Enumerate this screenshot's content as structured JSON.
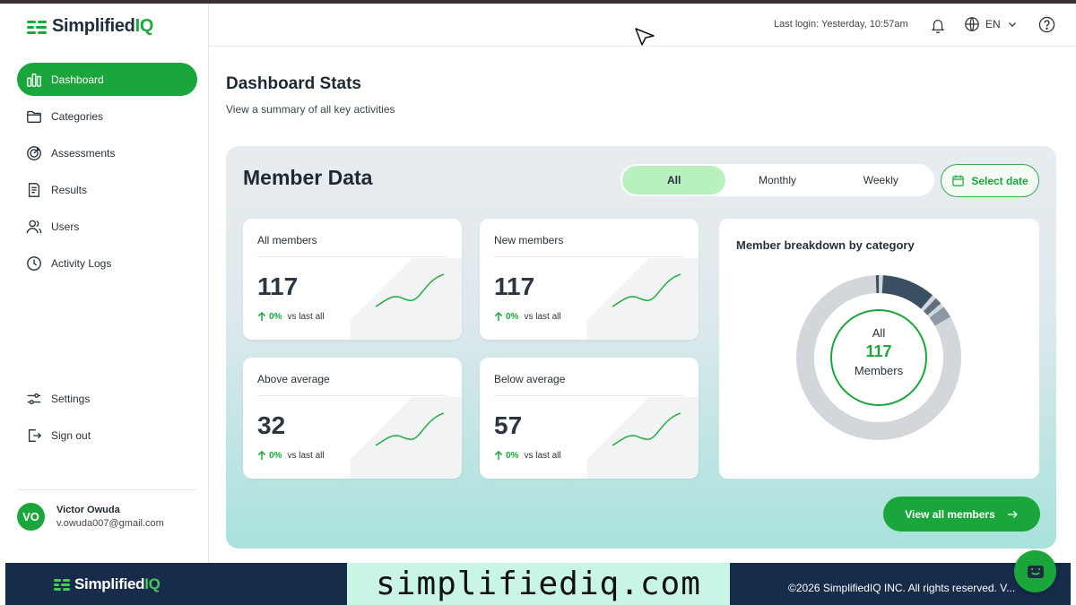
{
  "app": {
    "brand_prefix": "Simplified",
    "brand_suffix": "IQ",
    "accent_color": "#1aa63a"
  },
  "header": {
    "last_login": "Last login: Yesterday, 10:57am",
    "language": "EN"
  },
  "sidebar": {
    "items": [
      {
        "label": "Dashboard",
        "icon": "bar-chart-icon",
        "active": true
      },
      {
        "label": "Categories",
        "icon": "folder-icon"
      },
      {
        "label": "Assessments",
        "icon": "target-icon"
      },
      {
        "label": "Results",
        "icon": "document-icon"
      },
      {
        "label": "Users",
        "icon": "users-icon"
      },
      {
        "label": "Activity Logs",
        "icon": "clock-icon"
      }
    ],
    "bottom_items": [
      {
        "label": "Settings",
        "icon": "sliders-icon"
      },
      {
        "label": "Sign out",
        "icon": "sign-out-icon"
      }
    ],
    "profile": {
      "initials": "VO",
      "name": "Victor Owuda",
      "email": "v.owuda007@gmail.com"
    }
  },
  "main": {
    "title": "Dashboard Stats",
    "subtitle": "View a summary of all key activities",
    "panel": {
      "title": "Member Data",
      "tabs": [
        {
          "label": "All",
          "active": true
        },
        {
          "label": "Monthly"
        },
        {
          "label": "Weekly"
        }
      ],
      "select_date": "Select date",
      "cards": [
        {
          "title": "All members",
          "value": "117",
          "delta": "0%",
          "compare": "vs last all"
        },
        {
          "title": "New members",
          "value": "117",
          "delta": "0%",
          "compare": "vs last all"
        },
        {
          "title": "Above average",
          "value": "32",
          "delta": "0%",
          "compare": "vs last all"
        },
        {
          "title": "Below average",
          "value": "57",
          "delta": "0%",
          "compare": "vs last all"
        }
      ],
      "breakdown": {
        "title": "Member breakdown by category",
        "center_top": "All",
        "center_value": "117",
        "center_bottom": "Members"
      },
      "view_all": "View all members"
    }
  },
  "footer": {
    "brand_prefix": "Simplified",
    "brand_suffix": "IQ",
    "url": "simplifiediq.com",
    "copyright": "©2026 SimplifiedIQ INC. All rights reserved. V..."
  }
}
